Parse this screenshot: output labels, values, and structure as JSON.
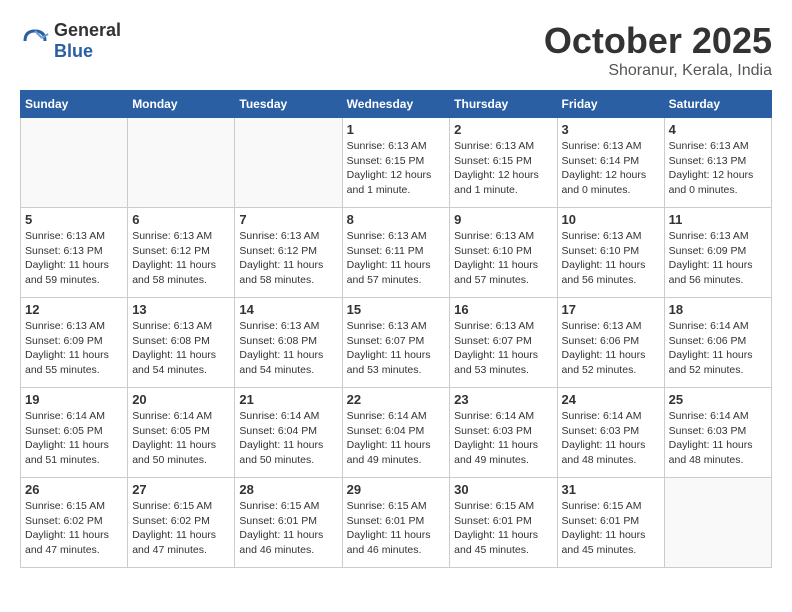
{
  "header": {
    "logo_general": "General",
    "logo_blue": "Blue",
    "month": "October 2025",
    "location": "Shoranur, Kerala, India"
  },
  "days_of_week": [
    "Sunday",
    "Monday",
    "Tuesday",
    "Wednesday",
    "Thursday",
    "Friday",
    "Saturday"
  ],
  "weeks": [
    [
      {
        "day": "",
        "info": ""
      },
      {
        "day": "",
        "info": ""
      },
      {
        "day": "",
        "info": ""
      },
      {
        "day": "1",
        "info": "Sunrise: 6:13 AM\nSunset: 6:15 PM\nDaylight: 12 hours\nand 1 minute."
      },
      {
        "day": "2",
        "info": "Sunrise: 6:13 AM\nSunset: 6:15 PM\nDaylight: 12 hours\nand 1 minute."
      },
      {
        "day": "3",
        "info": "Sunrise: 6:13 AM\nSunset: 6:14 PM\nDaylight: 12 hours\nand 0 minutes."
      },
      {
        "day": "4",
        "info": "Sunrise: 6:13 AM\nSunset: 6:13 PM\nDaylight: 12 hours\nand 0 minutes."
      }
    ],
    [
      {
        "day": "5",
        "info": "Sunrise: 6:13 AM\nSunset: 6:13 PM\nDaylight: 11 hours\nand 59 minutes."
      },
      {
        "day": "6",
        "info": "Sunrise: 6:13 AM\nSunset: 6:12 PM\nDaylight: 11 hours\nand 58 minutes."
      },
      {
        "day": "7",
        "info": "Sunrise: 6:13 AM\nSunset: 6:12 PM\nDaylight: 11 hours\nand 58 minutes."
      },
      {
        "day": "8",
        "info": "Sunrise: 6:13 AM\nSunset: 6:11 PM\nDaylight: 11 hours\nand 57 minutes."
      },
      {
        "day": "9",
        "info": "Sunrise: 6:13 AM\nSunset: 6:10 PM\nDaylight: 11 hours\nand 57 minutes."
      },
      {
        "day": "10",
        "info": "Sunrise: 6:13 AM\nSunset: 6:10 PM\nDaylight: 11 hours\nand 56 minutes."
      },
      {
        "day": "11",
        "info": "Sunrise: 6:13 AM\nSunset: 6:09 PM\nDaylight: 11 hours\nand 56 minutes."
      }
    ],
    [
      {
        "day": "12",
        "info": "Sunrise: 6:13 AM\nSunset: 6:09 PM\nDaylight: 11 hours\nand 55 minutes."
      },
      {
        "day": "13",
        "info": "Sunrise: 6:13 AM\nSunset: 6:08 PM\nDaylight: 11 hours\nand 54 minutes."
      },
      {
        "day": "14",
        "info": "Sunrise: 6:13 AM\nSunset: 6:08 PM\nDaylight: 11 hours\nand 54 minutes."
      },
      {
        "day": "15",
        "info": "Sunrise: 6:13 AM\nSunset: 6:07 PM\nDaylight: 11 hours\nand 53 minutes."
      },
      {
        "day": "16",
        "info": "Sunrise: 6:13 AM\nSunset: 6:07 PM\nDaylight: 11 hours\nand 53 minutes."
      },
      {
        "day": "17",
        "info": "Sunrise: 6:13 AM\nSunset: 6:06 PM\nDaylight: 11 hours\nand 52 minutes."
      },
      {
        "day": "18",
        "info": "Sunrise: 6:14 AM\nSunset: 6:06 PM\nDaylight: 11 hours\nand 52 minutes."
      }
    ],
    [
      {
        "day": "19",
        "info": "Sunrise: 6:14 AM\nSunset: 6:05 PM\nDaylight: 11 hours\nand 51 minutes."
      },
      {
        "day": "20",
        "info": "Sunrise: 6:14 AM\nSunset: 6:05 PM\nDaylight: 11 hours\nand 50 minutes."
      },
      {
        "day": "21",
        "info": "Sunrise: 6:14 AM\nSunset: 6:04 PM\nDaylight: 11 hours\nand 50 minutes."
      },
      {
        "day": "22",
        "info": "Sunrise: 6:14 AM\nSunset: 6:04 PM\nDaylight: 11 hours\nand 49 minutes."
      },
      {
        "day": "23",
        "info": "Sunrise: 6:14 AM\nSunset: 6:03 PM\nDaylight: 11 hours\nand 49 minutes."
      },
      {
        "day": "24",
        "info": "Sunrise: 6:14 AM\nSunset: 6:03 PM\nDaylight: 11 hours\nand 48 minutes."
      },
      {
        "day": "25",
        "info": "Sunrise: 6:14 AM\nSunset: 6:03 PM\nDaylight: 11 hours\nand 48 minutes."
      }
    ],
    [
      {
        "day": "26",
        "info": "Sunrise: 6:15 AM\nSunset: 6:02 PM\nDaylight: 11 hours\nand 47 minutes."
      },
      {
        "day": "27",
        "info": "Sunrise: 6:15 AM\nSunset: 6:02 PM\nDaylight: 11 hours\nand 47 minutes."
      },
      {
        "day": "28",
        "info": "Sunrise: 6:15 AM\nSunset: 6:01 PM\nDaylight: 11 hours\nand 46 minutes."
      },
      {
        "day": "29",
        "info": "Sunrise: 6:15 AM\nSunset: 6:01 PM\nDaylight: 11 hours\nand 46 minutes."
      },
      {
        "day": "30",
        "info": "Sunrise: 6:15 AM\nSunset: 6:01 PM\nDaylight: 11 hours\nand 45 minutes."
      },
      {
        "day": "31",
        "info": "Sunrise: 6:15 AM\nSunset: 6:01 PM\nDaylight: 11 hours\nand 45 minutes."
      },
      {
        "day": "",
        "info": ""
      }
    ]
  ]
}
